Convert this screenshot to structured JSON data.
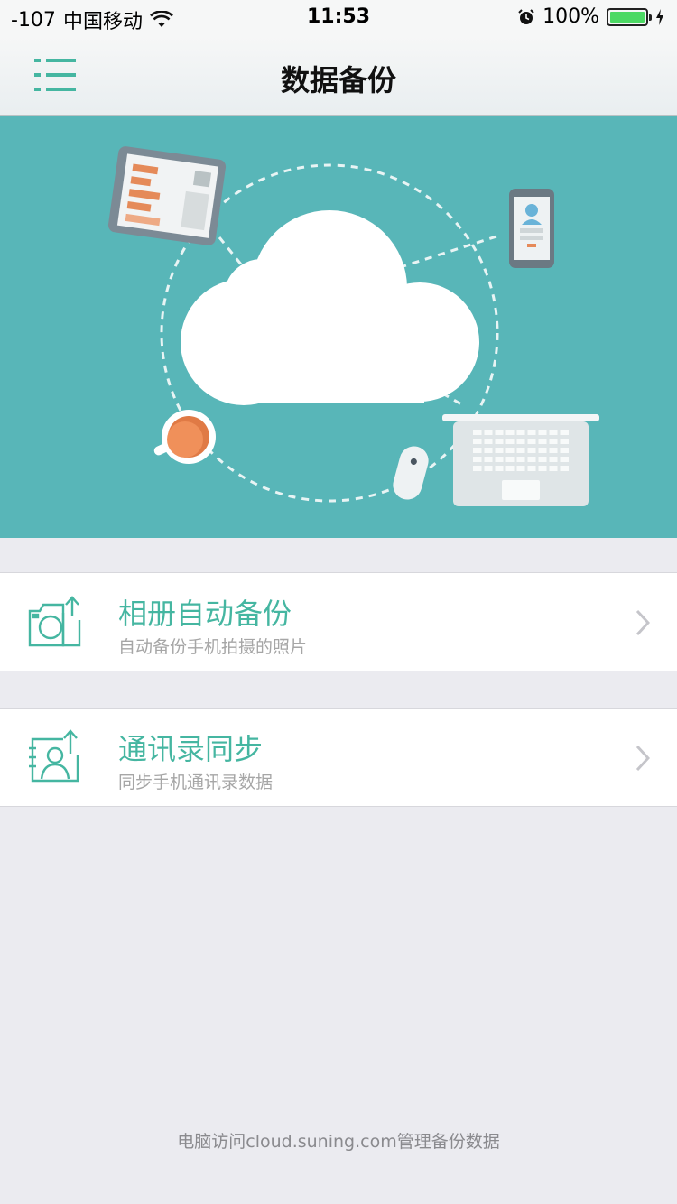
{
  "status_bar": {
    "signal": "-107",
    "carrier": "中国移动",
    "time": "11:53",
    "battery_text": "100%",
    "battery_level": 1.0,
    "icons": [
      "wifi-icon",
      "alarm-icon",
      "battery-icon",
      "charging-icon"
    ]
  },
  "nav": {
    "title": "数据备份",
    "menu_icon": "list-menu-icon"
  },
  "banner": {
    "illustration": "cloud-backup-illustration"
  },
  "items": [
    {
      "title": "相册自动备份",
      "subtitle": "自动备份手机拍摄的照片",
      "icon": "camera-upload-icon"
    },
    {
      "title": "通讯录同步",
      "subtitle": "同步手机通讯录数据",
      "icon": "contacts-upload-icon"
    }
  ],
  "footer": {
    "text": "电脑访问cloud.suning.com管理备份数据"
  },
  "colors": {
    "accent": "#45b6a1",
    "banner": "#58b6b8",
    "background": "#ebebf0"
  }
}
